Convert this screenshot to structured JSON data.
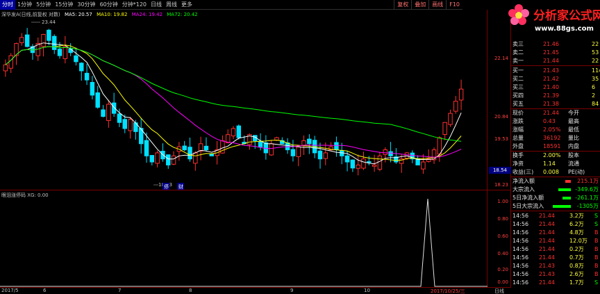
{
  "topbar": {
    "timeframes": [
      "分时",
      "1分钟",
      "5分钟",
      "15分钟",
      "30分钟",
      "60分钟",
      "分钟*120",
      "日线",
      "周线",
      "更多"
    ],
    "active_index": 0,
    "right_buttons": [
      "复权",
      "叠加",
      "画线",
      "F10"
    ]
  },
  "indicators": {
    "title": "深华发A(日线,前复权 对数)",
    "ma5": "MA5: 20.57",
    "ma10": "MA10: 19.82",
    "ma24": "MA24: 19.42",
    "ma72": "MA72: 20.42",
    "colors": {
      "ma5": "#ffffff",
      "ma10": "#ffff00",
      "ma24": "#ff00ff",
      "ma72": "#00ff00"
    }
  },
  "main_annotations": {
    "high": "23.44",
    "low": "18.93",
    "note_tag": "停",
    "note_tag2": "财"
  },
  "price_axis": [
    "22.14",
    "20.84",
    "19.53",
    "18.23"
  ],
  "price_tag": "18.54",
  "sub_chart": {
    "title": "眼泪涨停码 XG: 0.00",
    "axis": [
      "1.00",
      "0.80",
      "0.60",
      "0.40",
      "0.20",
      "0.00"
    ]
  },
  "date_axis": [
    "2017/5",
    "6",
    "7",
    "8",
    "9",
    "10",
    "2017/10/25/三",
    "日线"
  ],
  "logo": {
    "title": "分析家公式网",
    "url": "www.88gs.com"
  },
  "order_book": [
    {
      "label": "卖三",
      "price": "21.46",
      "vol": "22"
    },
    {
      "label": "卖二",
      "price": "21.45",
      "vol": "53"
    },
    {
      "label": "卖一",
      "price": "21.44",
      "vol": "22"
    },
    {
      "label": "买一",
      "price": "21.43",
      "vol": "114"
    },
    {
      "label": "买二",
      "price": "21.42",
      "vol": "35"
    },
    {
      "label": "买三",
      "price": "21.40",
      "vol": "6"
    },
    {
      "label": "买四",
      "price": "21.39",
      "vol": "2"
    },
    {
      "label": "买五",
      "price": "21.38",
      "vol": "84"
    }
  ],
  "quote": [
    {
      "l1": "现价",
      "v1": "21.44",
      "l2": "今开",
      "v2": ""
    },
    {
      "l1": "涨跌",
      "v1": "0.43",
      "l2": "最高",
      "v2": ""
    },
    {
      "l1": "涨幅",
      "v1": "2.05%",
      "l2": "最低",
      "v2": ""
    },
    {
      "l1": "总量",
      "v1": "36192",
      "l2": "量比",
      "v2": ""
    },
    {
      "l1": "外盘",
      "v1": "18591",
      "l2": "内盘",
      "v2": ""
    }
  ],
  "fundamentals": [
    {
      "l1": "换手",
      "v1": "2.00%",
      "l2": "股本",
      "v2": ""
    },
    {
      "l1": "净资",
      "v1": "1.14",
      "l2": "流通",
      "v2": ""
    },
    {
      "l1": "收益(三)",
      "v1": "0.008",
      "l2": "PE(动)",
      "v2": ""
    }
  ],
  "flows": [
    {
      "label": "净流入额",
      "value": "215.1万",
      "color": "red"
    },
    {
      "label": "大宗流入",
      "value": "-349.6万",
      "color": "green"
    },
    {
      "label": "5日净流入额",
      "value": "-261.1万",
      "color": "green"
    },
    {
      "label": "5日大宗流入",
      "value": "-1305万",
      "color": "green"
    }
  ],
  "ticks": [
    {
      "time": "14:56",
      "price": "21.44",
      "vol": "3.2万",
      "side": "S"
    },
    {
      "time": "14:56",
      "price": "21.44",
      "vol": "6.2万",
      "side": "S"
    },
    {
      "time": "14:56",
      "price": "21.44",
      "vol": "4.8万",
      "side": "B"
    },
    {
      "time": "14:56",
      "price": "21.44",
      "vol": "12.0万",
      "side": "B"
    },
    {
      "time": "14:56",
      "price": "21.44",
      "vol": "0.2万",
      "side": "B"
    },
    {
      "time": "14:56",
      "price": "21.44",
      "vol": "0.7万",
      "side": "B"
    },
    {
      "time": "14:56",
      "price": "21.43",
      "vol": "0.8万",
      "side": "B"
    },
    {
      "time": "14:56",
      "price": "21.43",
      "vol": "2.6万",
      "side": "B"
    },
    {
      "time": "14:56",
      "price": "21.44",
      "vol": "1.7万",
      "side": "S"
    }
  ]
}
